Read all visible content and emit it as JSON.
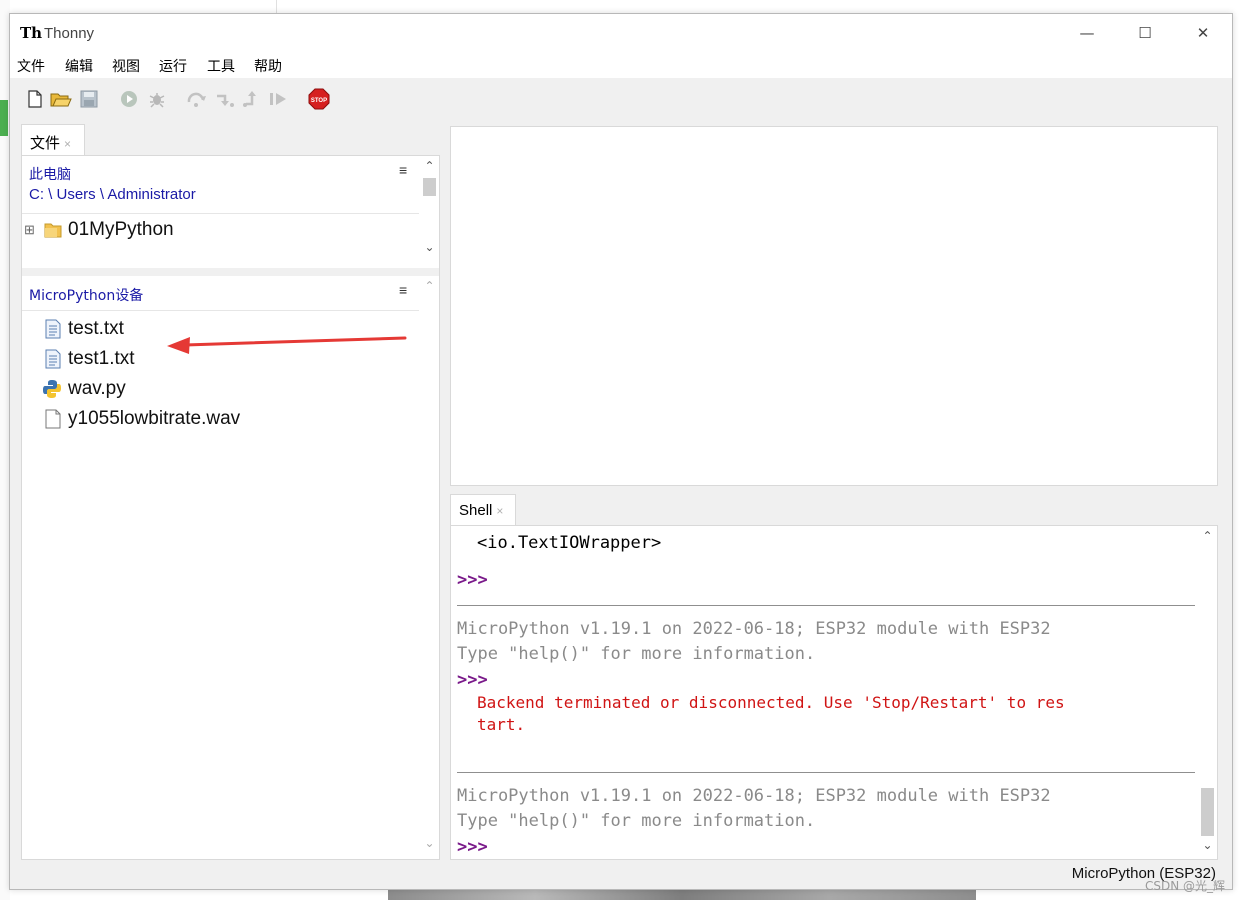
{
  "app": {
    "title": "Thonny",
    "icon_text": "Th"
  },
  "window_controls": {
    "minimize": "—",
    "maximize": "☐",
    "close": "✕"
  },
  "menubar": {
    "items": [
      "文件",
      "编辑",
      "视图",
      "运行",
      "工具",
      "帮助"
    ]
  },
  "toolbar": {
    "buttons": [
      "new-file",
      "open-file",
      "save-file",
      "run",
      "debug",
      "step-over",
      "step-into",
      "step-out",
      "resume",
      "stop"
    ],
    "stop_label": "STOP"
  },
  "files_tab": {
    "label": "文件",
    "close": "×"
  },
  "local": {
    "heading": "此电脑",
    "path": "C: \\ Users \\ Administrator",
    "items": [
      {
        "name": "01MyPython",
        "type": "folder",
        "expand": "⊞"
      }
    ]
  },
  "device": {
    "heading": "MicroPython设备",
    "items": [
      {
        "name": "test.txt",
        "type": "text"
      },
      {
        "name": "test1.txt",
        "type": "text"
      },
      {
        "name": "wav.py",
        "type": "python"
      },
      {
        "name": "y1055lowbitrate.wav",
        "type": "blank"
      }
    ]
  },
  "shell_tab": {
    "label": "Shell",
    "close": "×"
  },
  "shell": {
    "l1": "<io.TextIOWrapper>",
    "prompt": ">>>",
    "banner1": "MicroPython v1.19.1 on 2022-06-18; ESP32 module with ESP32",
    "banner2": "Type \"help()\" for more information.",
    "err1": "Backend terminated or disconnected. Use 'Stop/Restart' to res",
    "err2": "tart.",
    "banner3": "MicroPython v1.19.1 on 2022-06-18; ESP32 module with ESP32",
    "banner4": "Type \"help()\" for more information."
  },
  "status": {
    "backend": "MicroPython (ESP32)"
  },
  "watermark": "CSDN @光_辉",
  "colors": {
    "accent_link": "#1a1aa6",
    "prompt": "#7a1a8a",
    "error": "#d01414",
    "annotation_arrow": "#e53935"
  }
}
